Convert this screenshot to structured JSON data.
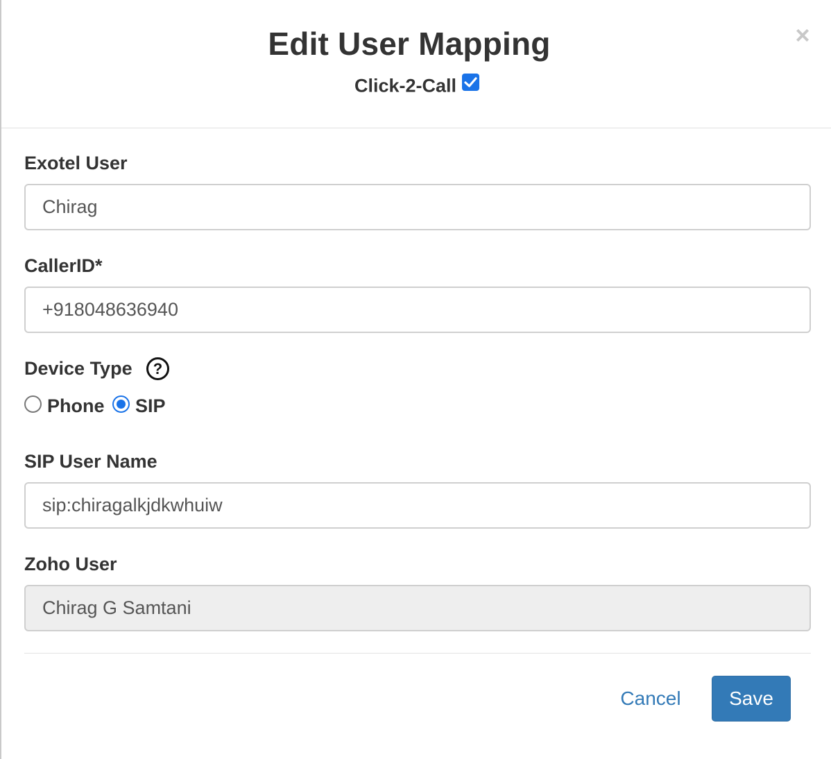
{
  "modal": {
    "title": "Edit User Mapping",
    "close_label": "×",
    "click2call": {
      "label": "Click-2-Call",
      "checked": true
    }
  },
  "form": {
    "exotel_user": {
      "label": "Exotel User",
      "value": "Chirag"
    },
    "caller_id": {
      "label": "CallerID*",
      "value": "+918048636940"
    },
    "device_type": {
      "label": "Device Type",
      "help_icon": "question-circle-icon",
      "help_glyph": "?",
      "options": [
        {
          "label": "Phone",
          "selected": false
        },
        {
          "label": "SIP",
          "selected": true
        }
      ]
    },
    "sip_user_name": {
      "label": "SIP User Name",
      "value": "sip:chiragalkjdkwhuiw"
    },
    "zoho_user": {
      "label": "Zoho User",
      "value": "Chirag G Samtani",
      "disabled": true
    }
  },
  "footer": {
    "cancel_label": "Cancel",
    "save_label": "Save"
  },
  "colors": {
    "primary": "#337ab7",
    "checkbox_accent": "#1a73e8",
    "disabled_bg": "#eeeeee"
  }
}
